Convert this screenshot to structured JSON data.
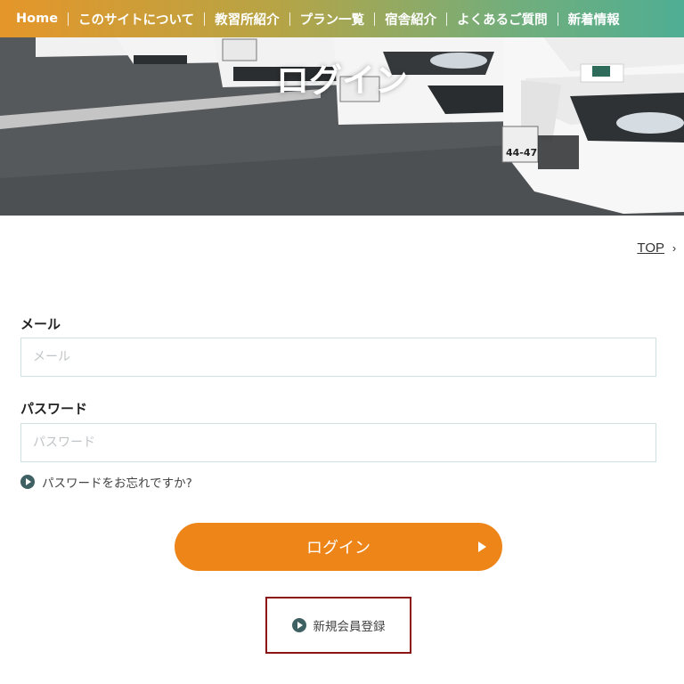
{
  "nav": {
    "items": [
      {
        "label": "Home"
      },
      {
        "label": "このサイトについて"
      },
      {
        "label": "教習所紹介"
      },
      {
        "label": "プラン一覧"
      },
      {
        "label": "宿舎紹介"
      },
      {
        "label": "よくあるご質問"
      },
      {
        "label": "新着情報"
      }
    ]
  },
  "hero": {
    "title": "ログイン",
    "plate_number": "44-47"
  },
  "breadcrumb": {
    "top_label": "TOP",
    "chevron": "›"
  },
  "form": {
    "email_label": "メール",
    "email_placeholder": "メール",
    "email_value": "",
    "password_label": "パスワード",
    "password_placeholder": "パスワード",
    "password_value": "",
    "forgot_label": "パスワードをお忘れですか?",
    "login_label": "ログイン",
    "register_label": "新規会員登録"
  },
  "colors": {
    "nav_gradient_start": "#e5962a",
    "nav_gradient_end": "#4fae93",
    "login_button": "#ee8519",
    "play_icon": "#3f6163",
    "highlight_border": "#8b1414"
  },
  "icons": {
    "forgot": "play-circle-icon",
    "register": "play-circle-icon",
    "login_arrow": "triangle-right-icon",
    "breadcrumb": "chevron-right-icon"
  }
}
